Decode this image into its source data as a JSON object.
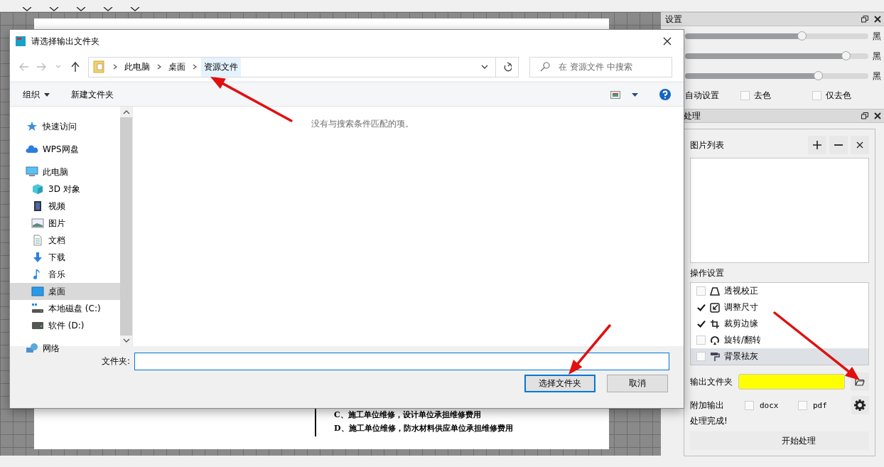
{
  "document": {
    "lines": [
      "C、施工单位维修，设计单位承担维修费用",
      "D、施工单位维修，防水材料供应单位承担维修费用"
    ]
  },
  "settings_panel": {
    "title": "设置",
    "sliders": [
      {
        "level": 0.64,
        "label": "黑"
      },
      {
        "level": 0.88,
        "label": "黑"
      },
      {
        "level": 0.73,
        "label": "黑"
      }
    ],
    "auto_label": "自动设置",
    "options": [
      {
        "label": "去色",
        "checked": false
      },
      {
        "label": "仅去色",
        "checked": false
      }
    ]
  },
  "process_panel": {
    "title": "处理",
    "image_list": {
      "title": "图片列表"
    },
    "operations_title": "操作设置",
    "operations": [
      {
        "label": "透视校正",
        "checked": false,
        "selected": false
      },
      {
        "label": "调整尺寸",
        "checked": true,
        "selected": false
      },
      {
        "label": "裁剪边缘",
        "checked": true,
        "selected": false
      },
      {
        "label": "旋转/翻转",
        "checked": false,
        "selected": false
      },
      {
        "label": "背景祛灰",
        "checked": false,
        "selected": true
      }
    ],
    "output_folder": {
      "label": "输出文件夹",
      "color": "#ffff00"
    },
    "extra_output": {
      "label": "附加输出",
      "options": [
        {
          "label": "docx",
          "checked": false
        },
        {
          "label": "pdf",
          "checked": false
        }
      ]
    },
    "status": "处理完成!",
    "start_button": "开始处理"
  },
  "dialog": {
    "title": "请选择输出文件夹",
    "breadcrumb": [
      {
        "label": "此电脑",
        "selected": false
      },
      {
        "label": "桌面",
        "selected": false
      },
      {
        "label": "资源文件",
        "selected": true
      }
    ],
    "search": {
      "placeholder": "在 资源文件 中搜索"
    },
    "toolbar": {
      "organize": "组织",
      "new_folder": "新建文件夹"
    },
    "nav": [
      {
        "label": "快速访问",
        "selected": false
      },
      {
        "label": "WPS网盘",
        "selected": false
      },
      {
        "label": "此电脑",
        "selected": false,
        "children": [
          {
            "label": "3D 对象",
            "selected": false
          },
          {
            "label": "视频",
            "selected": false
          },
          {
            "label": "图片",
            "selected": false
          },
          {
            "label": "文档",
            "selected": false
          },
          {
            "label": "下载",
            "selected": false
          },
          {
            "label": "音乐",
            "selected": false
          },
          {
            "label": "桌面",
            "selected": true
          },
          {
            "label": "本地磁盘 (C:)",
            "selected": false
          },
          {
            "label": "软件 (D:)",
            "selected": false
          }
        ]
      },
      {
        "label": "网络",
        "selected": false
      }
    ],
    "empty_message": "没有与搜索条件匹配的项。",
    "folder_label": "文件夹:",
    "buttons": [
      {
        "label": "选择文件夹",
        "kind": "primary"
      },
      {
        "label": "取消",
        "kind": "normal"
      }
    ]
  }
}
